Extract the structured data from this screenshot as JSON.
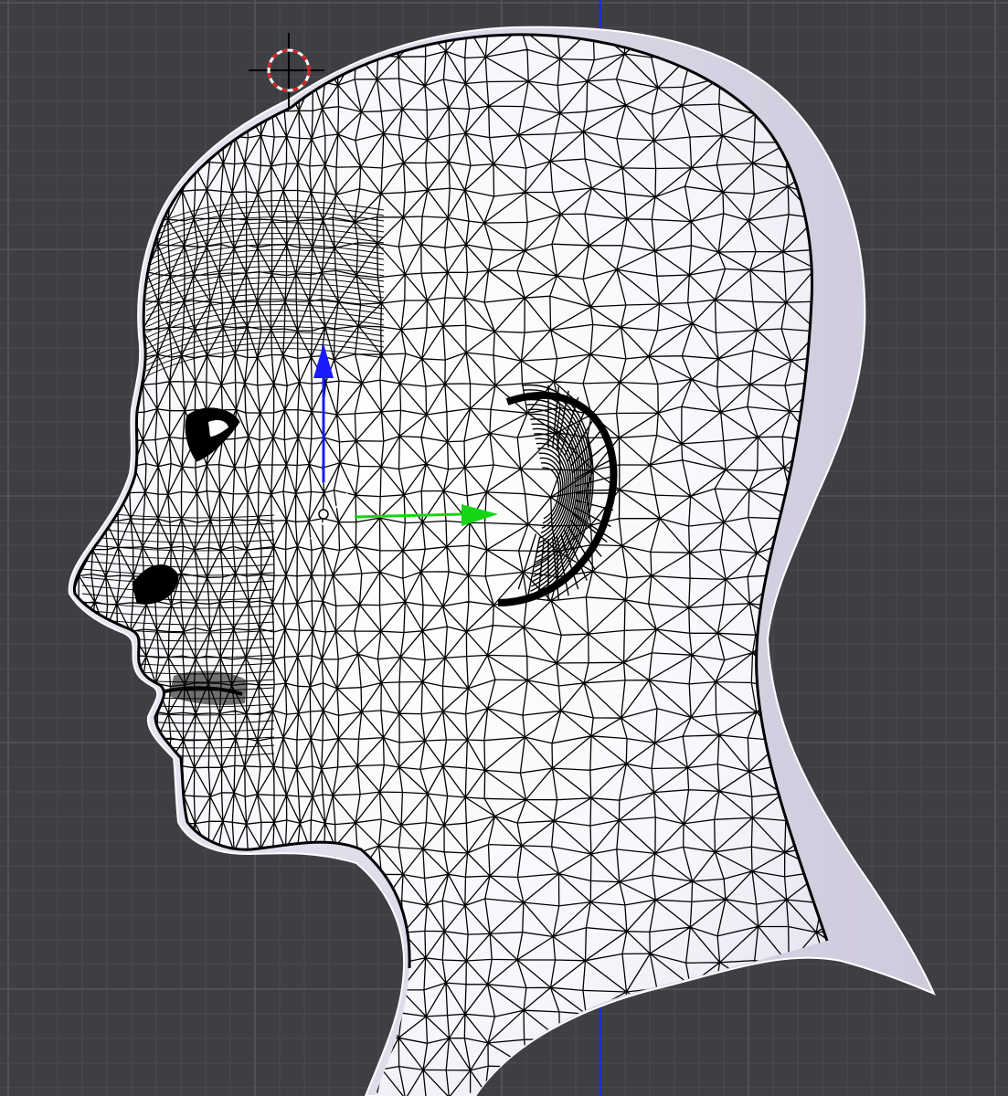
{
  "viewport": {
    "name": "3D viewport",
    "background_color": "#3d3f44",
    "grid_minor_color": "#4a4c52",
    "grid_major_color": "#55575d",
    "view_axis_color": "#1e2bd6"
  },
  "mesh": {
    "object": "head",
    "display": "wireframe-over-solid",
    "wire_color": "#000000",
    "surface_color": "#ffffff",
    "shadow_color": "#d8d4e6"
  },
  "gizmo": {
    "z_axis_color": "#1a1aff",
    "y_axis_color": "#14d614",
    "origin_icon": "origin-dot-icon"
  },
  "cursor_3d": {
    "icon": "3d-cursor-icon",
    "ring_colors": [
      "#d42020",
      "#ffffff"
    ]
  }
}
